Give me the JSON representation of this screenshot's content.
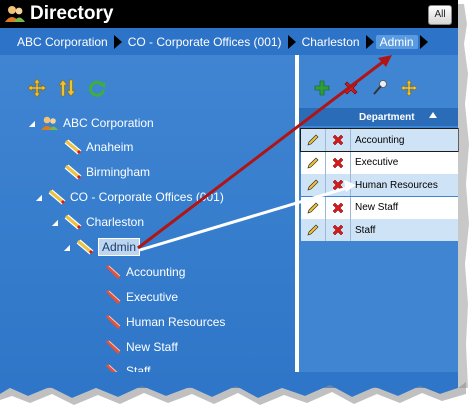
{
  "title": {
    "text": "Directory",
    "icon": "users-icon"
  },
  "all_button": "All",
  "breadcrumb": [
    "ABC Corporation",
    "CO - Corporate Offices (001)",
    "Charleston",
    "Admin"
  ],
  "tree_toolbar": [
    "expand-collapse-icon",
    "sort-icon",
    "refresh-icon"
  ],
  "tree": [
    {
      "label": "ABC Corporation",
      "icon": "users-icon",
      "expander": "collapse"
    },
    {
      "label": "Anaheim",
      "icon": "location-icon",
      "expander": ""
    },
    {
      "label": "Birmingham",
      "icon": "location-icon",
      "expander": ""
    },
    {
      "label": "CO - Corporate Offices (001)",
      "icon": "location-icon",
      "expander": "collapse"
    },
    {
      "label": "Charleston",
      "icon": "location-icon",
      "expander": "collapse"
    },
    {
      "label": "Admin",
      "icon": "location-icon",
      "expander": "collapse",
      "selected": true
    },
    {
      "label": "Accounting",
      "icon": "department-icon",
      "expander": ""
    },
    {
      "label": "Executive",
      "icon": "department-icon",
      "expander": ""
    },
    {
      "label": "Human Resources",
      "icon": "department-icon",
      "expander": ""
    },
    {
      "label": "New Staff",
      "icon": "department-icon",
      "expander": ""
    },
    {
      "label": "Staff",
      "icon": "department-icon",
      "expander": ""
    }
  ],
  "grid_toolbar": [
    "add-icon",
    "delete-icon",
    "pin-icon",
    "move-icon"
  ],
  "grid": {
    "column": "Department",
    "sort": "ascending",
    "rows": [
      "Accounting",
      "Executive",
      "Human Resources",
      "New Staff",
      "Staff"
    ]
  },
  "colors": {
    "panel": "#3f85d2",
    "breadcrumb": "#2d73c8",
    "arrow_red": "#b01515",
    "arrow_white": "#ffffff"
  }
}
